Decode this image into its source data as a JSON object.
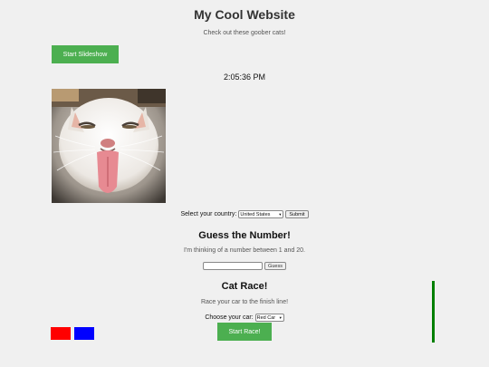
{
  "header": {
    "title": "My Cool Website",
    "tagline": "Check out these goober cats!"
  },
  "slideshow": {
    "button_label": "Start Slideshow"
  },
  "clock": {
    "time": "2:05:36 PM"
  },
  "cat_image": {
    "icon": "cat-photo"
  },
  "country_form": {
    "label": "Select your country:",
    "selected": "United States",
    "submit_label": "Submit"
  },
  "guess_game": {
    "title": "Guess the Number!",
    "description": "I'm thinking of a number between 1 and 20.",
    "input_value": "",
    "button_label": "Guess"
  },
  "cat_race": {
    "title": "Cat Race!",
    "description": "Race your car to the finish line!",
    "car_label": "Choose your car:",
    "car_selected": "Red Car",
    "button_label": "Start Race!",
    "cars": [
      {
        "name": "red-car",
        "color": "#ff0000"
      },
      {
        "name": "blue-car",
        "color": "#0000ff"
      }
    ],
    "finish_line_color": "#008000"
  },
  "colors": {
    "accent": "#4caf50",
    "background": "#f0f0f0"
  }
}
